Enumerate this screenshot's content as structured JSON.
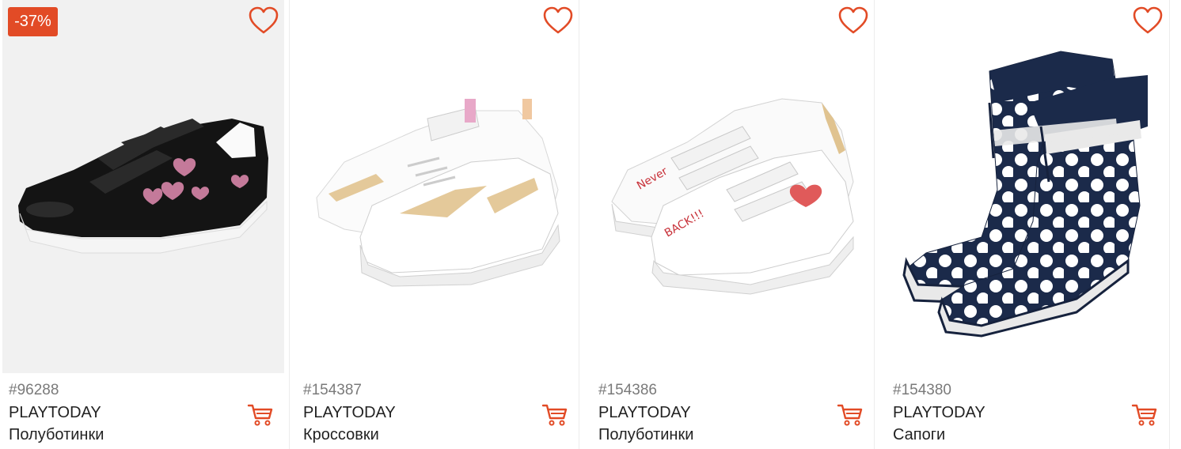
{
  "colors": {
    "accent": "#e24b26",
    "image_bg": "#f1f1f1"
  },
  "icons": {
    "favorite": "heart-outline-icon",
    "cart": "shopping-cart-icon"
  },
  "products": [
    {
      "discount": "-37%",
      "sku": "#96288",
      "brand": "PLAYTODAY",
      "name": "Полуботинки"
    },
    {
      "sku": "#154387",
      "brand": "PLAYTODAY",
      "name": "Кроссовки"
    },
    {
      "sku": "#154386",
      "brand": "PLAYTODAY",
      "name": "Полуботинки"
    },
    {
      "sku": "#154380",
      "brand": "PLAYTODAY",
      "name": "Сапоги"
    }
  ]
}
